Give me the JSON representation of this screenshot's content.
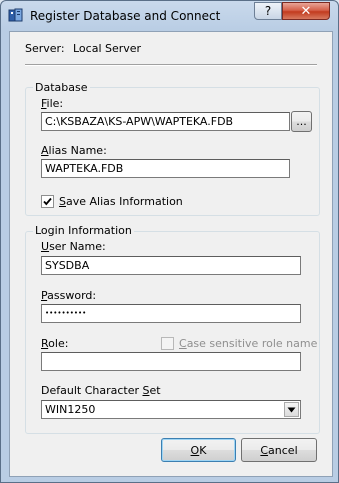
{
  "window": {
    "title": "Register Database and Connect",
    "help_glyph": "?",
    "close_glyph": "✕"
  },
  "server": {
    "label": "Server:",
    "value": "Local Server"
  },
  "database_group": {
    "legend": "Database",
    "file_label_first": "F",
    "file_label_rest": "ile:",
    "file_value": "C:\\KSBAZA\\KS-APW\\WAPTEKA.FDB",
    "browse_label": "...",
    "alias_label_first": "A",
    "alias_label_rest": "lias Name:",
    "alias_value": "WAPTEKA.FDB",
    "save_alias_first": "S",
    "save_alias_rest": "ave Alias Information",
    "save_alias_checked": true
  },
  "login_group": {
    "legend": "Login Information",
    "user_label_first": "U",
    "user_label_rest": "ser Name:",
    "user_value": "SYSDBA",
    "password_label_first": "P",
    "password_label_rest": "assword:",
    "password_value": "••••••••••",
    "role_label_first": "R",
    "role_label_rest": "ole:",
    "role_value": "",
    "case_sensitive_first": "C",
    "case_sensitive_rest": "ase sensitive role name",
    "case_sensitive_checked": false,
    "charset_label_main": "Default Character  ",
    "charset_label_first": "S",
    "charset_label_rest": "et",
    "charset_value": "WIN1250"
  },
  "buttons": {
    "ok_first": "O",
    "ok_rest": "K",
    "cancel_first": "C",
    "cancel_rest": "ancel"
  }
}
